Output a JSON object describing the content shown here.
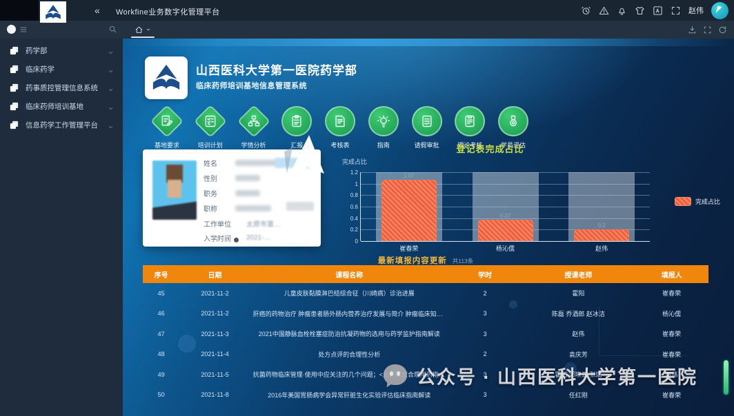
{
  "colors": {
    "accent_orange": "#f1860d",
    "bar_orange": "#ef5f3e",
    "icon_green": "#2bb35f",
    "title_yellow": "#c9dd45",
    "banner_gold": "#f0b43c",
    "main_blue": "#0d568e"
  },
  "titlebar": {
    "collapse": "«",
    "title": "Workfine业务数字化管理平台",
    "username": "赵伟",
    "icons": [
      "alarm-icon",
      "alert-icon",
      "bell-icon",
      "theme-shirt-icon",
      "translate-icon",
      "expand-icon"
    ]
  },
  "tabbar": {
    "right_icons": [
      "download-icon",
      "fullscreen-icon",
      "refresh-icon"
    ]
  },
  "sidebar": {
    "items": [
      "药学部",
      "临床药学",
      "药事质控管理信息系统",
      "临床药师培训基地",
      "信息药学工作管理平台"
    ]
  },
  "header": {
    "org_title": "山西医科大学第一医院药学部",
    "org_subtitle": "临床药师培训基地信息管理系统"
  },
  "nav_icons": [
    {
      "label": "基地要求",
      "shape": "diamond",
      "glyph": "doc-pen-icon"
    },
    {
      "label": "培训计划",
      "shape": "diamond",
      "glyph": "checklist-icon"
    },
    {
      "label": "学情分析",
      "shape": "diamond",
      "glyph": "org-chart-icon"
    },
    {
      "label": "汇报",
      "shape": "circle",
      "glyph": "clipboard-icon"
    },
    {
      "label": "考核表",
      "shape": "circle",
      "glyph": "certificate-icon"
    },
    {
      "label": "指南",
      "shape": "circle",
      "glyph": "bulb-icon"
    },
    {
      "label": "请假审批",
      "shape": "circle",
      "glyph": "doc-wave-icon"
    },
    {
      "label": "理论考核",
      "shape": "circle",
      "glyph": "clipboard-check-icon"
    },
    {
      "label": "学员评估",
      "shape": "circle",
      "glyph": "medal-icon"
    }
  ],
  "profile": {
    "fields": [
      {
        "label": "姓名",
        "value": ""
      },
      {
        "label": "性别",
        "value": ""
      },
      {
        "label": "职务",
        "value": ""
      },
      {
        "label": "职称",
        "value": ""
      },
      {
        "label": "工作单位",
        "value": "太原市第…"
      },
      {
        "label": "入学时间",
        "value": "2021-…"
      }
    ]
  },
  "chart_data": {
    "type": "bar",
    "title": "登记表完成占比",
    "ylabel": "完成占比",
    "categories": [
      "崔春荣",
      "杨沁儒",
      "赵伟"
    ],
    "values": [
      1.07,
      0.37,
      0.2
    ],
    "value_labels": [
      "1.07",
      "0.37",
      "0.2"
    ],
    "ylim": [
      0,
      1.2
    ],
    "yticks": [
      "1.2",
      "1",
      "0.8",
      "0.6",
      "0.4",
      "0.2",
      "0"
    ],
    "legend": [
      "完成占比"
    ],
    "legend_position": "right",
    "grid": true,
    "track_full_value": 1.2
  },
  "update_banner": {
    "title": "最新填报内容更新",
    "count": "共113条"
  },
  "table": {
    "headers": [
      "序号",
      "日期",
      "课程名称",
      "学时",
      "授课老师",
      "填报人"
    ],
    "rows": [
      [
        "45",
        "2021-11-2",
        "儿童皮肤黏膜淋巴结综合征（川崎病）诊治进展",
        "2",
        "霍阳",
        "崔春荣"
      ],
      [
        "46",
        "2021-11-2",
        "肝癌的药物治疗 肿瘤患者肠外肠内营养治疗发展与简介 肿瘤临床知识简介 肿瘤常用化…",
        "3",
        "陈磊 乔酒郎 赵冰洁",
        "杨沁儒"
      ],
      [
        "47",
        "2021-11-3",
        "2021中国静脉血栓栓塞症防治抗凝药物的选用与药学监护指南解读",
        "3",
        "赵伟",
        "崔春荣"
      ],
      [
        "48",
        "2021-11-4",
        "处方点评的合理性分析",
        "2",
        "袁庆芳",
        "崔春荣"
      ],
      [
        "49",
        "2021-11-5",
        "抗菌药物临床管理·使用中应关注的几个问题；<血药浓度合理用药指南>解读；心内科…",
        "3",
        "霍阳 郭晓云 张瑞",
        "赵伟"
      ],
      [
        "50",
        "2021-11-8",
        "2016年美国胃肠病学会异常肝脏生化实验评估临床指南解读",
        "3",
        "任红刚",
        "崔春荣"
      ]
    ]
  },
  "watermark": "公众号 · 山西医科大学第一医院"
}
